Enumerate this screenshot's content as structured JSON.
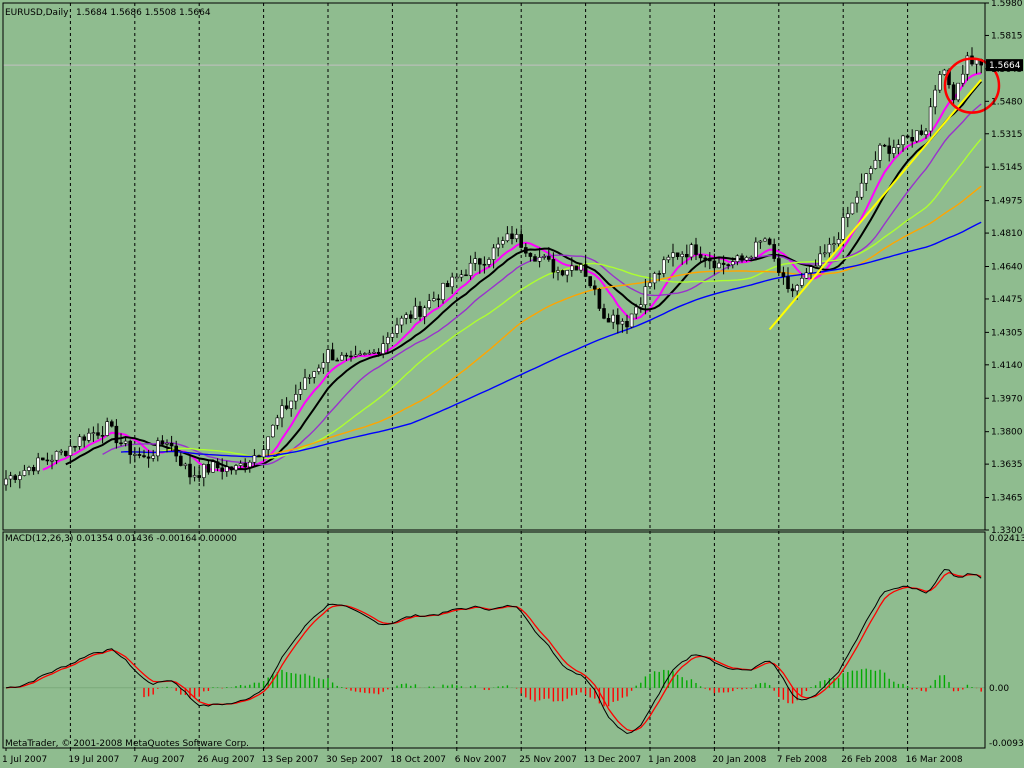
{
  "window": {
    "title": "EURUSD,Daily",
    "ohlc": "1.5684 1.5686 1.5508 1.5664",
    "copyright": "MetaTrader, © 2001-2008 MetaQuotes Software Corp."
  },
  "colors": {
    "background": "#8fbc8f",
    "grid": "#000000",
    "candle": "#000000",
    "ma_magenta": "#ff00ff",
    "ma_black": "#000000",
    "ma_purple": "#9932cc",
    "ma_lime": "#adff2f",
    "ma_orange": "#ffa500",
    "ma_blue": "#0000ff",
    "trendline": "#ffff00",
    "circle": "#ff0000",
    "macd_main": "#000000",
    "macd_signal": "#ff0000",
    "hist_pos": "#00aa00",
    "hist_neg": "#ff0000"
  },
  "chart_data": [
    {
      "type": "candlestick",
      "title": "EURUSD,Daily",
      "current_price": "1.5664",
      "ylim": [
        1.33,
        1.598
      ],
      "y_ticks": [
        "1.5980",
        "1.5815",
        "1.5645",
        "1.5480",
        "1.5315",
        "1.5145",
        "1.4975",
        "1.4810",
        "1.4640",
        "1.4475",
        "1.4305",
        "1.4140",
        "1.3970",
        "1.3800",
        "1.3635",
        "1.3465",
        "1.3300"
      ],
      "x_ticks": [
        "1 Jul 2007",
        "19 Jul 2007",
        "7 Aug 2007",
        "26 Aug 2007",
        "13 Sep 2007",
        "30 Sep 2007",
        "18 Oct 2007",
        "6 Nov 2007",
        "25 Nov 2007",
        "13 Dec 2007",
        "1 Jan 2008",
        "20 Jan 2008",
        "7 Feb 2008",
        "26 Feb 2008",
        "16 Mar 2008"
      ],
      "close_anchors": [
        [
          0,
          1.356
        ],
        [
          6,
          1.363
        ],
        [
          12,
          1.369
        ],
        [
          17,
          1.378
        ],
        [
          22,
          1.382
        ],
        [
          26,
          1.372
        ],
        [
          30,
          1.366
        ],
        [
          35,
          1.376
        ],
        [
          40,
          1.358
        ],
        [
          45,
          1.362
        ],
        [
          50,
          1.361
        ],
        [
          55,
          1.37
        ],
        [
          60,
          1.39
        ],
        [
          65,
          1.405
        ],
        [
          70,
          1.42
        ],
        [
          75,
          1.415
        ],
        [
          80,
          1.42
        ],
        [
          85,
          1.435
        ],
        [
          90,
          1.442
        ],
        [
          95,
          1.452
        ],
        [
          100,
          1.462
        ],
        [
          105,
          1.47
        ],
        [
          110,
          1.48
        ],
        [
          115,
          1.47
        ],
        [
          120,
          1.462
        ],
        [
          125,
          1.466
        ],
        [
          130,
          1.44
        ],
        [
          135,
          1.436
        ],
        [
          140,
          1.456
        ],
        [
          145,
          1.47
        ],
        [
          150,
          1.473
        ],
        [
          155,
          1.465
        ],
        [
          160,
          1.467
        ],
        [
          165,
          1.478
        ],
        [
          170,
          1.45
        ],
        [
          175,
          1.461
        ],
        [
          180,
          1.476
        ],
        [
          185,
          1.5
        ],
        [
          190,
          1.523
        ],
        [
          195,
          1.527
        ],
        [
          200,
          1.535
        ],
        [
          203,
          1.565
        ],
        [
          206,
          1.552
        ],
        [
          209,
          1.57
        ],
        [
          212,
          1.5664
        ]
      ],
      "moving_averages": [
        {
          "color_key": "ma_magenta",
          "period": 8
        },
        {
          "color_key": "ma_black",
          "period": 13
        },
        {
          "color_key": "ma_purple",
          "period": 21
        },
        {
          "color_key": "ma_lime",
          "period": 34
        },
        {
          "color_key": "ma_orange",
          "period": 55
        },
        {
          "color_key": "ma_blue",
          "period": 89
        }
      ],
      "trendline": {
        "from": [
          166,
          1.432
        ],
        "to": [
          212,
          1.559
        ]
      },
      "circle_at": [
        210,
        1.556
      ]
    },
    {
      "type": "macd",
      "title": "MACD(12,26,3) 0.01354 0.01436 -0.00164 0.00000",
      "params": [
        12,
        26,
        3
      ],
      "ylim": [
        -0.00931,
        0.02413
      ],
      "y_ticks": [
        "0.02413",
        "0.00",
        "-0.00931"
      ]
    }
  ]
}
